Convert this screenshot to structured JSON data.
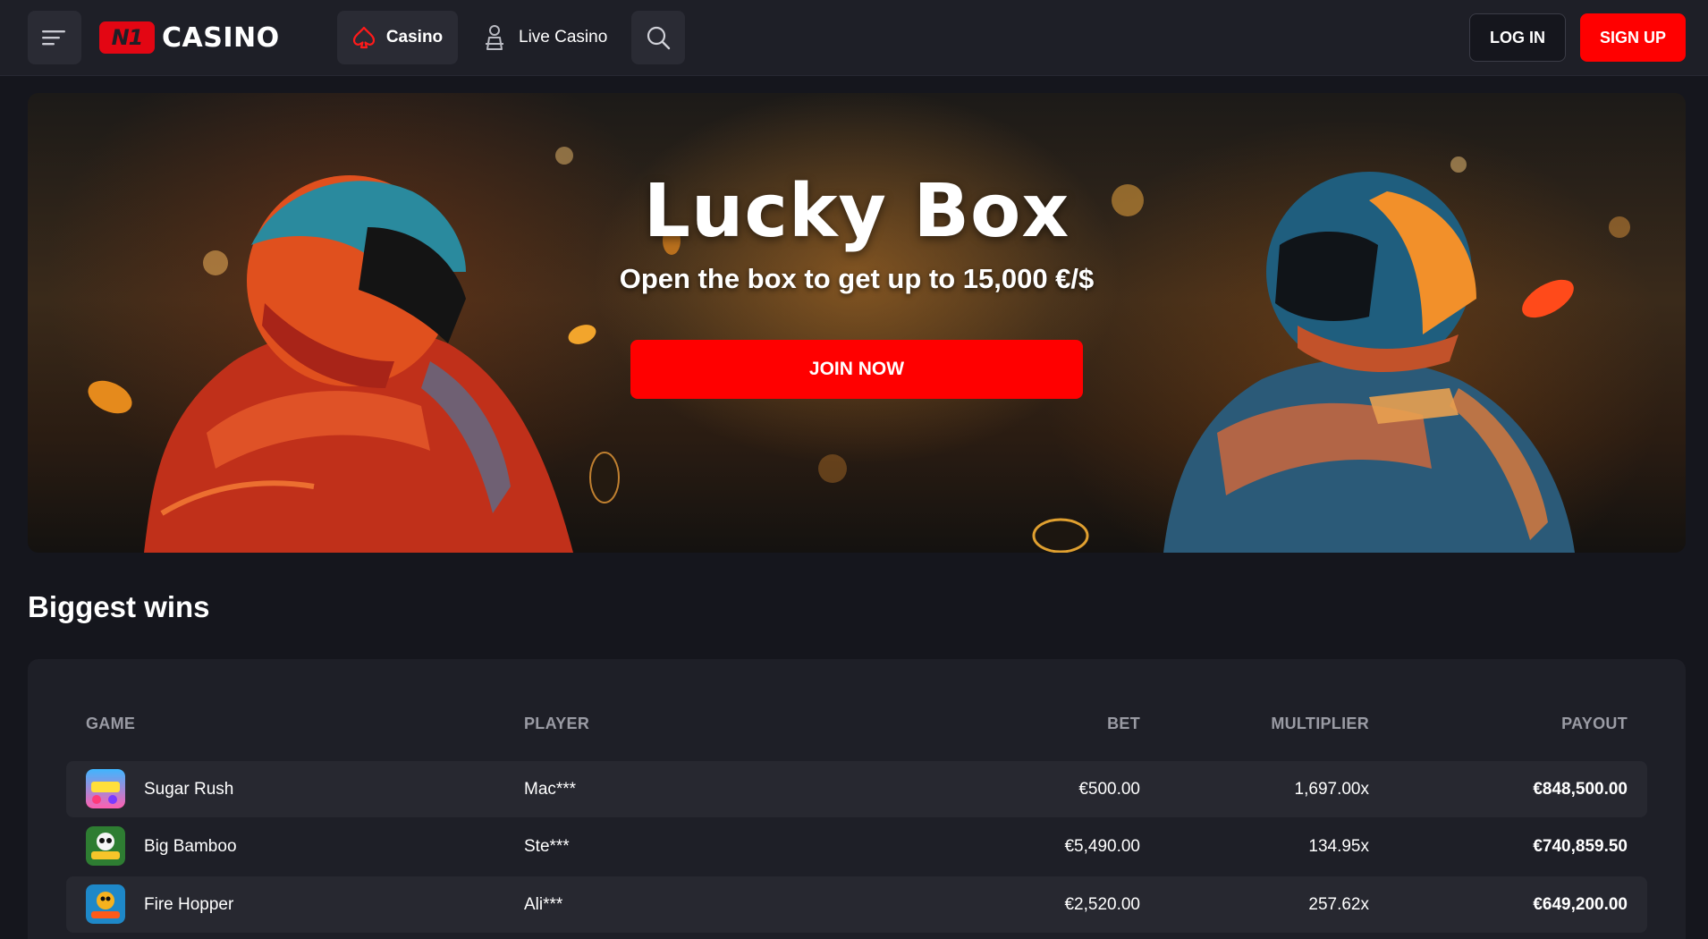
{
  "header": {
    "logo_badge": "N1",
    "logo_text": "CASINO",
    "nav": [
      {
        "label": "Casino",
        "icon": "spade-icon"
      },
      {
        "label": "Live Casino",
        "icon": "dealer-icon"
      }
    ],
    "login_label": "LOG IN",
    "signup_label": "SIGN UP"
  },
  "banner": {
    "title": "Lucky Box",
    "subtitle": "Open the box to get up to 15,000 €/$",
    "cta_label": "JOIN NOW"
  },
  "biggest_wins": {
    "title": "Biggest wins",
    "columns": [
      "GAME",
      "PLAYER",
      "BET",
      "MULTIPLIER",
      "PAYOUT"
    ],
    "rows": [
      {
        "game": "Sugar Rush",
        "player": "Mac***",
        "bet": "€500.00",
        "multiplier": "1,697.00x",
        "payout": "€848,500.00"
      },
      {
        "game": "Big Bamboo",
        "player": "Ste***",
        "bet": "€5,490.00",
        "multiplier": "134.95x",
        "payout": "€740,859.50"
      },
      {
        "game": "Fire Hopper",
        "player": "Ali***",
        "bet": "€2,520.00",
        "multiplier": "257.62x",
        "payout": "€649,200.00"
      }
    ]
  },
  "colors": {
    "accent": "#ff0000",
    "background": "#15161d",
    "panel": "#1e1f27"
  }
}
